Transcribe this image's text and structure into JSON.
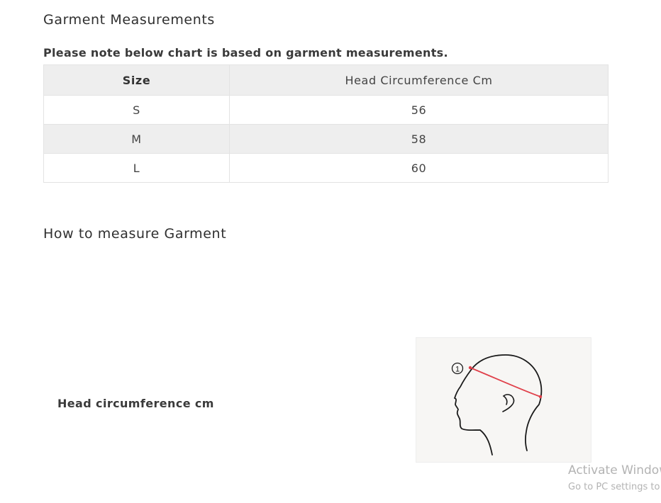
{
  "garment_section": {
    "title": "Garment Measurements",
    "note": "Please note below chart is based on garment measurements."
  },
  "size_table": {
    "headers": [
      "Size",
      "Head Circumference Cm"
    ],
    "rows": [
      [
        "S",
        "56"
      ],
      [
        "M",
        "58"
      ],
      [
        "L",
        "60"
      ]
    ]
  },
  "howto_section": {
    "title": "How to measure Garment",
    "measurement_label": "Head circumference cm",
    "illustration": {
      "icon": "head-profile-measurement",
      "marker": "①",
      "line_color": "#e0404a"
    }
  },
  "watermark": {
    "title": "Activate Windows",
    "subtitle": "Go to PC settings to activate Windows."
  }
}
